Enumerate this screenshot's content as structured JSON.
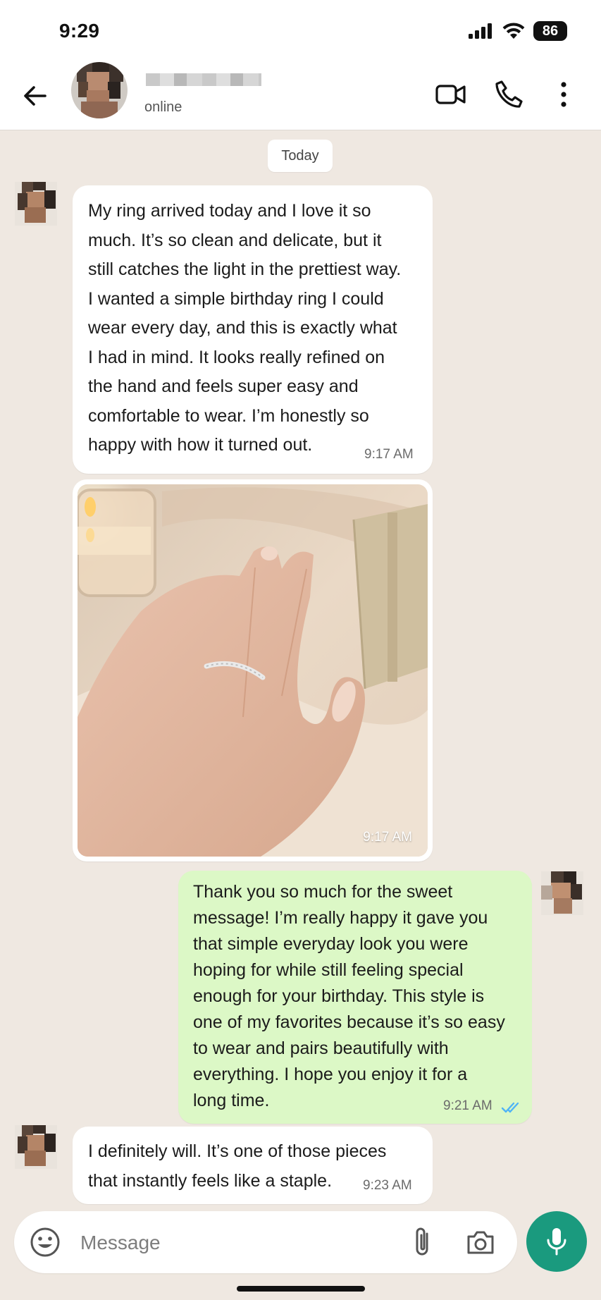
{
  "status_bar": {
    "time": "9:29",
    "battery": "86"
  },
  "header": {
    "contact_status": "online"
  },
  "chat": {
    "date_chip": "Today",
    "messages": [
      {
        "direction": "incoming",
        "text": "My ring arrived today and I love it so\nmuch. It’s so clean and delicate, but it\nstill catches the light in the prettiest way.\nI wanted a simple birthday ring I could\nwear every day, and this is exactly what\nI had in mind. It looks really refined on\nthe hand and feels super easy and\ncomfortable to wear. I’m honestly so\nhappy with how it turned out.",
        "time": "9:17 AM"
      },
      {
        "direction": "incoming",
        "type": "image",
        "time": "9:17 AM"
      },
      {
        "direction": "outgoing",
        "text": "Thank you so much for the sweet\nmessage! I’m really happy it gave you\nthat simple everyday look you were\nhoping for while still feeling special\nenough for your birthday. This style is\none of my favorites because it’s so easy\nto wear and pairs beautifully with\neverything. I hope you enjoy it for a\nlong time.",
        "time": "9:21 AM",
        "read": true
      },
      {
        "direction": "incoming",
        "text": "I definitely will. It’s one of those pieces\nthat instantly feels like a staple.",
        "time": "9:23 AM"
      }
    ]
  },
  "composer": {
    "placeholder": "Message"
  },
  "colors": {
    "accent": "#1a9a7e",
    "outgoing_bubble": "#dcf8c6",
    "incoming_bubble": "#ffffff",
    "read_ticks": "#4fb3f6"
  }
}
